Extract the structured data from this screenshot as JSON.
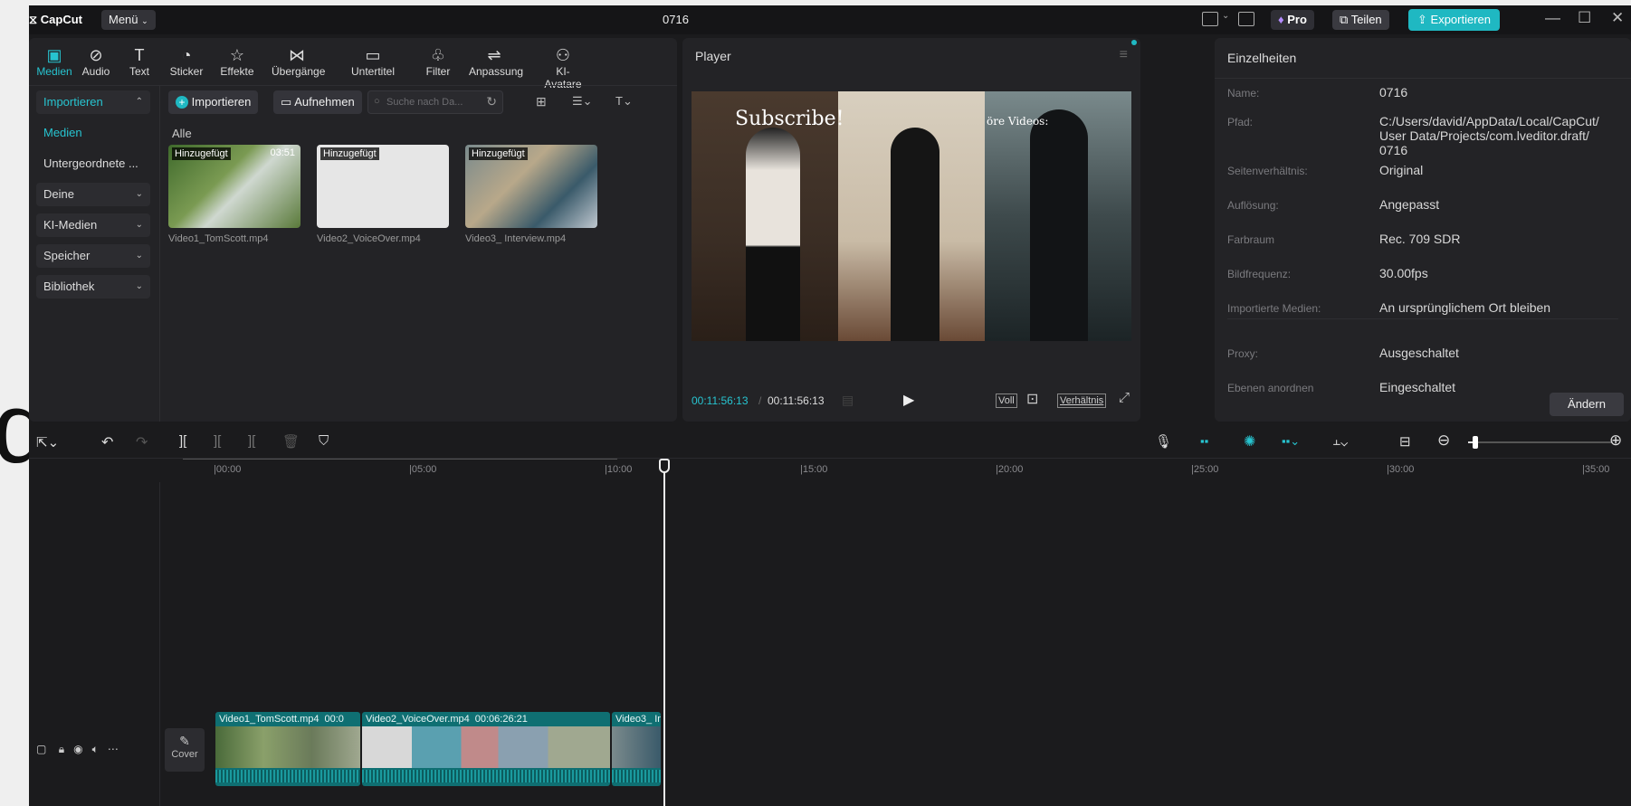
{
  "background_glyph": "d",
  "titlebar": {
    "app_name": "CapCut",
    "menu_label": "Menü",
    "project_title": "0716",
    "pro_label": "Pro",
    "share_label": "Teilen",
    "export_label": "Exportieren",
    "accent_color": "#1fb8c2"
  },
  "toolbar": {
    "tools": [
      {
        "label": "Medien",
        "icon": "media-icon"
      },
      {
        "label": "Audio",
        "icon": "audio-icon"
      },
      {
        "label": "Text",
        "icon": "text-icon"
      },
      {
        "label": "Sticker",
        "icon": "sticker-icon"
      },
      {
        "label": "Effekte",
        "icon": "effects-icon"
      },
      {
        "label": "Übergänge",
        "icon": "transitions-icon"
      },
      {
        "label": "Untertitel",
        "icon": "subtitles-icon"
      },
      {
        "label": "Filter",
        "icon": "filter-icon"
      },
      {
        "label": "Anpassung",
        "icon": "adjust-icon"
      },
      {
        "label": "KI-Avatare",
        "icon": "ai-avatar-icon"
      }
    ]
  },
  "media_sidebar": {
    "items": [
      {
        "label": "Importieren"
      },
      {
        "label": "Medien"
      },
      {
        "label": "Untergeordnete ..."
      },
      {
        "label": "Deine"
      },
      {
        "label": "KI-Medien"
      },
      {
        "label": "Speicher"
      },
      {
        "label": "Bibliothek"
      }
    ]
  },
  "media_panel": {
    "import_label": "Importieren",
    "record_label": "Aufnehmen",
    "search_placeholder": "Suche nach Da...",
    "filter_all": "Alle",
    "clips": [
      {
        "tag": "Hinzugefügt",
        "duration": "03:51",
        "name": "Video1_TomScott.mp4"
      },
      {
        "tag": "Hinzugefügt",
        "duration": "",
        "name": "Video2_VoiceOver.mp4"
      },
      {
        "tag": "Hinzugefügt",
        "duration": "",
        "name": "Video3_ Interview.mp4"
      }
    ]
  },
  "player": {
    "title": "Player",
    "overlay_subscribe": "Subscribe!",
    "overlay_more": "öre Videos:",
    "current_time": "00:11:56:13",
    "total_time": "00:11:56:13",
    "full_label": "Voll",
    "ratio_label": "Verhältnis"
  },
  "details": {
    "title": "Einzelheiten",
    "rows": [
      {
        "label": "Name:",
        "value": "0716"
      },
      {
        "label": "Pfad:",
        "value": "C:/Users/david/AppData/Local/CapCut/ User Data/Projects/com.lveditor.draft/ 0716"
      },
      {
        "label": "Seitenverhältnis:",
        "value": "Original"
      },
      {
        "label": "Auflösung:",
        "value": "Angepasst"
      },
      {
        "label": "Farbraum",
        "value": "Rec. 709 SDR"
      },
      {
        "label": "Bildfrequenz:",
        "value": "30.00fps"
      },
      {
        "label": "Importierte Medien:",
        "value": "An ursprünglichem Ort bleiben"
      },
      {
        "label": "Proxy:",
        "value": "Ausgeschaltet"
      },
      {
        "label": "Ebenen anordnen",
        "value": "Eingeschaltet"
      }
    ],
    "change_label": "Ändern"
  },
  "timeline": {
    "ruler": [
      "|00:00",
      "|05:00",
      "|10:00",
      "|15:00",
      "|20:00",
      "|25:00",
      "|30:00",
      "|35:00"
    ],
    "cover_label": "Cover",
    "clips": [
      {
        "name": "Video1_TomScott.mp4",
        "duration": "00:0"
      },
      {
        "name": "Video2_VoiceOver.mp4",
        "duration": "00:06:26:21"
      },
      {
        "name": "Video3_ Inte",
        "duration": ""
      }
    ],
    "zoom_level": 0.05
  }
}
